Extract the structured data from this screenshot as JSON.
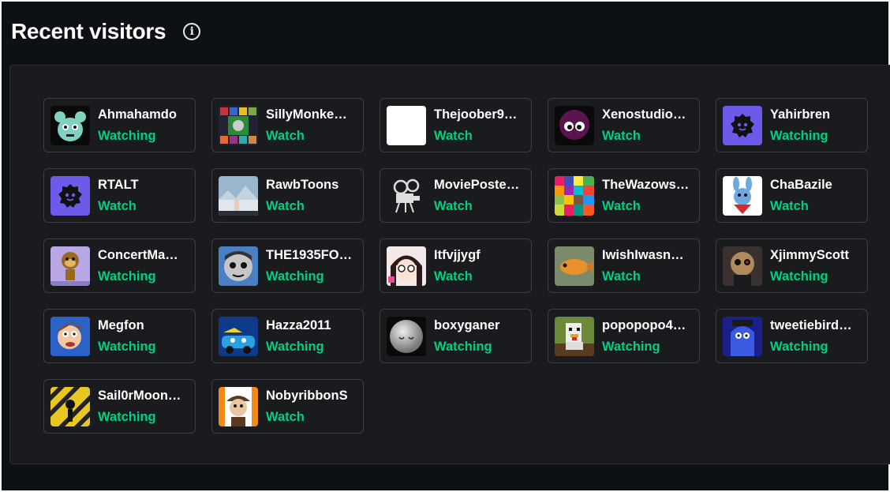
{
  "header": {
    "title": "Recent visitors",
    "info_icon": "info-icon"
  },
  "colors": {
    "status": "#00d082",
    "panel": "#191b1f",
    "background": "#0d1015"
  },
  "visitors": [
    {
      "name": "Ahmahamdo",
      "status": "Watching",
      "avatar": "teal-cat-character"
    },
    {
      "name": "SillyMonke…",
      "status": "Watch",
      "avatar": "collage-train"
    },
    {
      "name": "Thejoober9…",
      "status": "Watch",
      "avatar": "blank-white"
    },
    {
      "name": "Xenostudio…",
      "status": "Watch",
      "avatar": "purple-blob"
    },
    {
      "name": "Yahirbren",
      "status": "Watching",
      "avatar": "default-purple"
    },
    {
      "name": "RTALT",
      "status": "Watch",
      "avatar": "default-purple"
    },
    {
      "name": "RawbToons",
      "status": "Watch",
      "avatar": "snowy-scene"
    },
    {
      "name": "MoviePoste…",
      "status": "Watch",
      "avatar": "film-projector"
    },
    {
      "name": "TheWazows…",
      "status": "Watch",
      "avatar": "colorful-collage"
    },
    {
      "name": "ChaBazile",
      "status": "Watch",
      "avatar": "cartoon-bunny"
    },
    {
      "name": "ConcertMa…",
      "status": "Watching",
      "avatar": "monkey-character"
    },
    {
      "name": "THE1935FO…",
      "status": "Watching",
      "avatar": "grey-face-character"
    },
    {
      "name": "Itfvjjygf",
      "status": "Watch",
      "avatar": "anime-girl"
    },
    {
      "name": "IwishIwasn…",
      "status": "Watch",
      "avatar": "orange-fish"
    },
    {
      "name": "XjimmyScott",
      "status": "Watching",
      "avatar": "animatronic"
    },
    {
      "name": "Megfon",
      "status": "Watching",
      "avatar": "cartoon-face"
    },
    {
      "name": "Hazza2011",
      "status": "Watching",
      "avatar": "blue-cars"
    },
    {
      "name": "boxyganer",
      "status": "Watching",
      "avatar": "grey-smiley-ball"
    },
    {
      "name": "popopopo4…",
      "status": "Watching",
      "avatar": "pixel-chicken"
    },
    {
      "name": "tweetiebird…",
      "status": "Watching",
      "avatar": "blue-character"
    },
    {
      "name": "Sail0rMoon…",
      "status": "Watching",
      "avatar": "yellow-caution-collage"
    },
    {
      "name": "NobyribbonS",
      "status": "Watch",
      "avatar": "orange-character"
    }
  ]
}
